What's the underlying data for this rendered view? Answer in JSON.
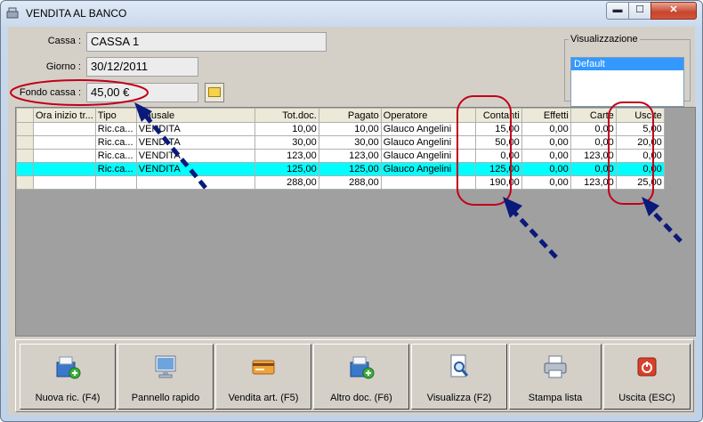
{
  "window": {
    "title": "VENDITA AL BANCO",
    "min": "▬",
    "max": "☐",
    "close": "✕"
  },
  "form": {
    "cassa_label": "Cassa :",
    "cassa_value": "CASSA 1",
    "giorno_label": "Giorno :",
    "giorno_value": "30/12/2011",
    "fondo_label": "Fondo cassa :",
    "fondo_value": "45,00 €"
  },
  "visualizzazione": {
    "legend": "Visualizzazione",
    "items": [
      "Default"
    ]
  },
  "table": {
    "headers": [
      "Ora inizio tr...",
      "Tipo",
      "Causale",
      "Tot.doc.",
      "Pagato",
      "Operatore",
      "Contanti",
      "Effetti",
      "Carte",
      "Uscite"
    ],
    "rows": [
      {
        "ora": "",
        "tipo": "Ric.ca...",
        "causale": "VENDITA",
        "tot": "10,00",
        "pagato": "10,00",
        "operatore": "Glauco Angelini",
        "contanti": "15,00",
        "effetti": "0,00",
        "carte": "0,00",
        "uscite": "5,00"
      },
      {
        "ora": "",
        "tipo": "Ric.ca...",
        "causale": "VENDITA",
        "tot": "30,00",
        "pagato": "30,00",
        "operatore": "Glauco Angelini",
        "contanti": "50,00",
        "effetti": "0,00",
        "carte": "0,00",
        "uscite": "20,00"
      },
      {
        "ora": "",
        "tipo": "Ric.ca...",
        "causale": "VENDITA",
        "tot": "123,00",
        "pagato": "123,00",
        "operatore": "Glauco Angelini",
        "contanti": "0,00",
        "effetti": "0,00",
        "carte": "123,00",
        "uscite": "0,00"
      },
      {
        "ora": "",
        "tipo": "Ric.ca...",
        "causale": "VENDITA",
        "tot": "125,00",
        "pagato": "125,00",
        "operatore": "Glauco Angelini",
        "contanti": "125,00",
        "effetti": "0,00",
        "carte": "0,00",
        "uscite": "0,00"
      }
    ],
    "totals": {
      "tot": "288,00",
      "pagato": "288,00",
      "contanti": "190,00",
      "effetti": "0,00",
      "carte": "123,00",
      "uscite": "25,00"
    }
  },
  "toolbar": {
    "buttons": [
      "Nuova ric. (F4)",
      "Pannello rapido",
      "Vendita art. (F5)",
      "Altro doc. (F6)",
      "Visualizza (F2)",
      "Stampa lista",
      "Uscita (ESC)"
    ]
  },
  "colors": {
    "annotation": "#c0001a",
    "arrow": "#0a1a7a",
    "selected_row": "#00ffff"
  }
}
